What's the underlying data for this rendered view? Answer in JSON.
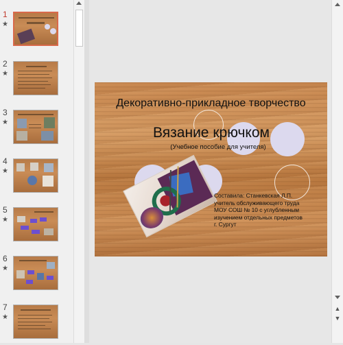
{
  "thumbnails": [
    {
      "number": "1",
      "star": "★",
      "selected": true
    },
    {
      "number": "2",
      "star": "★",
      "selected": false
    },
    {
      "number": "3",
      "star": "★",
      "selected": false
    },
    {
      "number": "4",
      "star": "★",
      "selected": false
    },
    {
      "number": "5",
      "star": "★",
      "selected": false
    },
    {
      "number": "6",
      "star": "★",
      "selected": false
    },
    {
      "number": "7",
      "star": "★",
      "selected": false
    }
  ],
  "slide": {
    "heading": "Декоративно-прикладное творчество",
    "title": "Вязание крючком",
    "subtitle": "(Учебное пособие для учителя)",
    "author_lines": [
      "Составила: Станкевская Л.П.",
      "учитель обслуживающего труда",
      "МОУ СОШ № 10 с углубленным",
      "изучением отдельных предметов",
      "г. Сургут"
    ]
  },
  "colors": {
    "wood": "#c8874f",
    "circle_fill": "#dcd9ee",
    "selected_border": "#d9694b"
  },
  "icons": {
    "prev_slide": "double-up-arrow-icon",
    "next_slide": "double-down-arrow-icon"
  }
}
